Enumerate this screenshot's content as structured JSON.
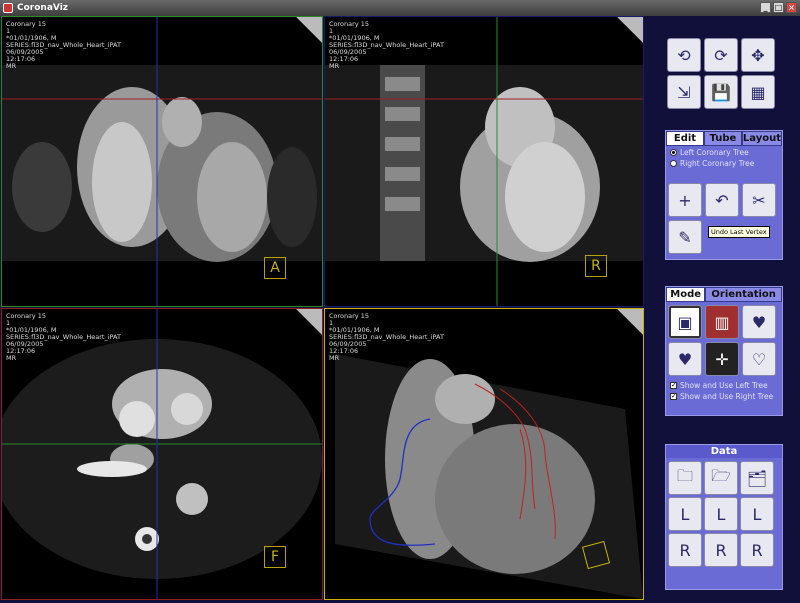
{
  "window": {
    "title": "CoronaViz"
  },
  "viewports": {
    "overlay": [
      "Coronary 15",
      "1",
      "*01/01/1906, M",
      "SERIES:fl3D_nav_Whole_Heart_iPAT",
      "06/09/2005",
      "12:17:06",
      "MR"
    ],
    "labels": {
      "a": "A",
      "r": "R",
      "f": "F"
    }
  },
  "panel_tools": {
    "tabs": [
      "Edit",
      "Tube",
      "Layout"
    ],
    "active_tab": "Edit"
  },
  "edit_panel": {
    "radios": [
      {
        "label": "Left Coronary Tree",
        "selected": true
      },
      {
        "label": "Right Coronary Tree",
        "selected": false
      }
    ],
    "tooltip": "Undo Last Vertex"
  },
  "mode_panel": {
    "tabs": [
      "Mode",
      "Orientation"
    ],
    "active_tab": "Mode",
    "checks": [
      {
        "label": "Show and Use Left Tree",
        "checked": true
      },
      {
        "label": "Show and Use Right Tree",
        "checked": true
      }
    ]
  },
  "data_panel": {
    "title": "Data",
    "letters": [
      "L",
      "L",
      "L",
      "R",
      "R",
      "R"
    ]
  },
  "colors": {
    "panel": "#6b6bd6",
    "background": "#10103a",
    "left_tree": "#c02020",
    "right_tree": "#2030c0"
  }
}
